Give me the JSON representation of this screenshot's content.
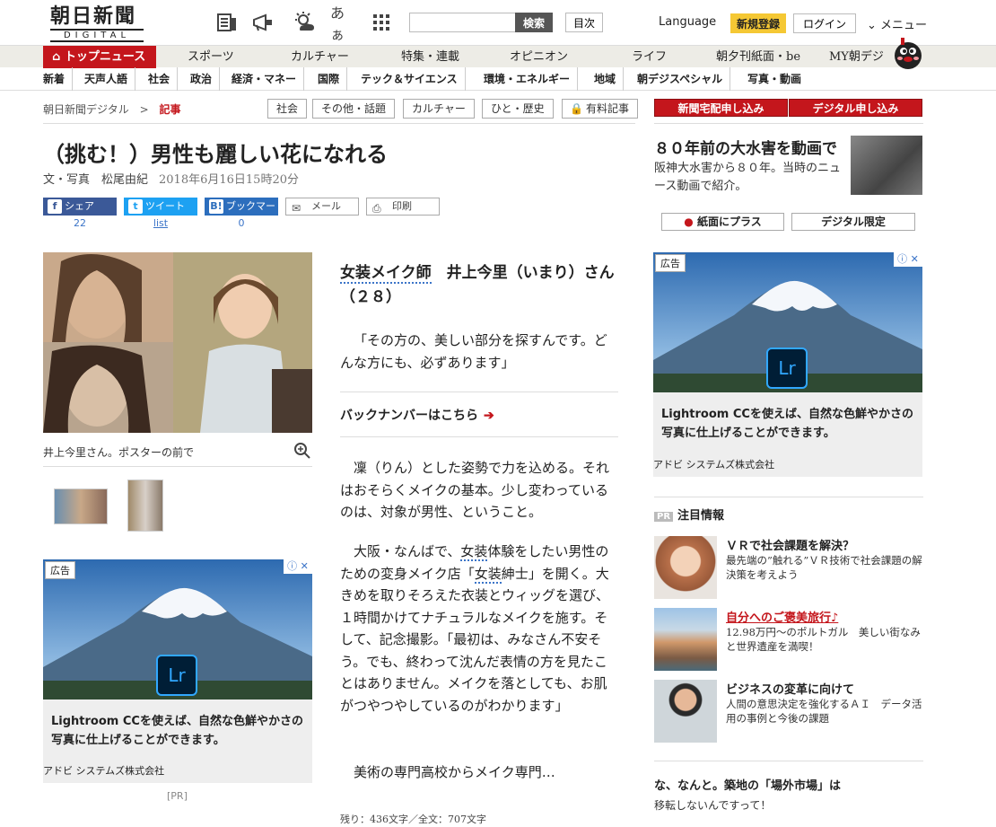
{
  "header": {
    "logo_line1": "朝日新聞",
    "logo_line2": "DIGITAL",
    "icons": [
      "news-icon",
      "megaphone-icon",
      "weather-icon",
      "font-size-icon",
      "grid-menu-icon"
    ],
    "font_size_label": "あぁ",
    "search_button": "検索",
    "index_button": "目次",
    "language": "Language",
    "register": "新規登録",
    "login": "ログイン",
    "menu": "メニュー"
  },
  "nav1": {
    "top": "トップニュース",
    "items": [
      "スポーツ",
      "カルチャー",
      "特集・連載",
      "オピニオン",
      "ライフ",
      "朝夕刊紙面・be",
      "MY朝デジ"
    ]
  },
  "nav2": {
    "items": [
      "新着",
      "天声人語",
      "社会",
      "政治",
      "経済・マネー",
      "国際",
      "テック＆サイエンス",
      "環境・エネルギー",
      "地域",
      "朝デジスペシャル",
      "写真・動画"
    ]
  },
  "breadcrumb": {
    "root": "朝日新聞デジタル",
    "sep": ">",
    "current": "記事"
  },
  "tags": [
    "社会",
    "その他・話題",
    "カルチャー",
    "ひと・歴史",
    "有料記事"
  ],
  "article": {
    "title": "（挑む！）男性も麗しい花になれる",
    "byline": "文・写真　松尾由紀",
    "date": "2018年6月16日15時20分",
    "share": {
      "facebook": "シェア",
      "facebook_count": "22",
      "twitter": "ツイート",
      "twitter_count": "list",
      "bookmark": "ブックマーク",
      "bookmark_count": "0",
      "mail": "メール",
      "print": "印刷"
    },
    "photo_caption": "井上今里さん。ポスターの前で",
    "profile_link": "女装メイク師",
    "profile_rest": "　井上今里（いまり）さん（２８）",
    "quote": "「その方の、美しい部分を探すんです。どんな方にも、必ずあります」",
    "back_numbers": "バックナンバーはこちら",
    "p1": "凜（りん）とした姿勢で力を込める。それはおそらくメイクの基本。少し変わっているのは、対象が男性、ということ。",
    "p2a": "大阪・なんばで、",
    "p2_link1": "女装",
    "p2b": "体験をしたい男性のための変身メイク店「",
    "p2_link2": "女装",
    "p2c": "紳士」を開く。大きめを取りそろえた衣装とウィッグを選び、１時間かけてナチュラルなメイクを施す。そして、記念撮影。「最初は、みなさん不安そう。でも、終わって沈んだ表情の方を見たことはありません。メイクを落としても、お肌がつやつやしているのがわかります」",
    "p3": "美術の専門高校からメイク専門…",
    "remaining": "残り：436文字／全文：707文字"
  },
  "ads": {
    "label": "広告",
    "logo": "Lr",
    "text": "Lightroom CCを使えば、自然な色鮮やかさの写真に仕上げることができます。",
    "sponsor": "アドビ システムズ株式会社",
    "pr": "[PR]"
  },
  "right": {
    "cta1": "新聞宅配申し込み",
    "cta2": "デジタル申し込み",
    "head": "８０年前の大水害を動画で",
    "sub": "阪神大水害から８０年。当時のニュース動画で紹介。",
    "btn1": "紙面にプラス",
    "btn2": "デジタル限定",
    "pr_badge": "PR",
    "pr_title": "注目情報",
    "pr_items": [
      {
        "title": "ＶＲで社会課題を解決？",
        "desc": "最先端の”触れる”ＶＲ技術で社会課題の解決策を考えよう"
      },
      {
        "title": "自分へのご褒美旅行♪",
        "desc": "12.98万円〜のポルトガル　美しい街なみと世界遺産を満喫！"
      },
      {
        "title": "ビジネスの変革に向けて",
        "desc": "人間の意思決定を強化するＡＩ　データ活用の事例と今後の課題"
      }
    ],
    "bottom_head": "な、なんと。築地の「場外市場」は",
    "bottom_sub": "移転しないんですって！"
  },
  "colors": {
    "brand_red": "#c4161c",
    "link_blue": "#3b74c8",
    "facebook": "#3b5998",
    "twitter": "#1da1f2",
    "hatena": "#2c6ebd"
  }
}
